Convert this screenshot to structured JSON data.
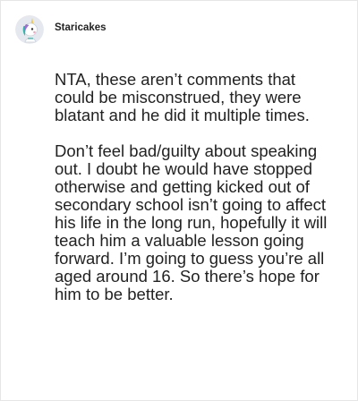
{
  "post": {
    "username": "Staricakes",
    "avatar_icon": "unicorn-avatar-icon",
    "paragraphs": [
      "NTA, these aren’t comments that could be misconstrued, they were blatant and he did it multiple times.",
      "Don’t feel bad/guilty about speaking out. I doubt he would have stopped otherwise and getting kicked out of secondary school isn’t going to affect his life in the long run, hopefully it will teach him a valuable lesson going forward. I’m going to guess you’re all aged around 16. So there’s hope for him to be better."
    ]
  },
  "colors": {
    "text": "#222222",
    "card_border": "#e6e6e6",
    "avatar_bg": "#e5e9ef",
    "avatar_accent": "#37b3a8"
  }
}
